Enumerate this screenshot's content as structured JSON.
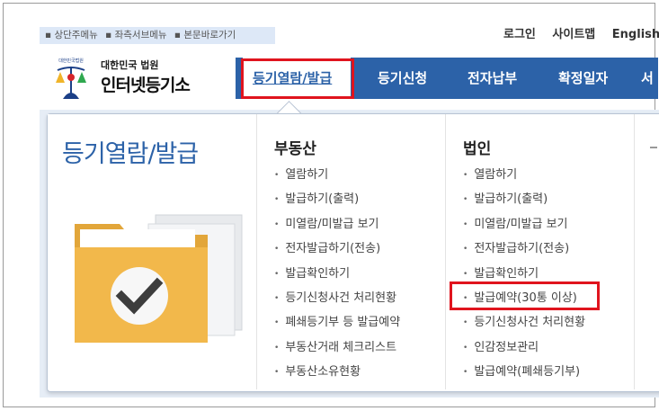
{
  "skip_nav": [
    "상단주메뉴",
    "좌측서브메뉴",
    "본문바로가기"
  ],
  "util_nav": [
    "로그인",
    "사이트맵",
    "English"
  ],
  "logo": {
    "emblem_text": "대한민국법원",
    "line1": "대한민국 법원",
    "line2": "인터넷등기소"
  },
  "gnb": [
    "등기열람/발급",
    "등기신청",
    "전자납부",
    "확정일자",
    "서"
  ],
  "dropdown": {
    "title": "등기열람/발급",
    "columns": [
      {
        "heading": "부동산",
        "items": [
          "열람하기",
          "발급하기(출력)",
          "미열람/미발급 보기",
          "전자발급하기(전송)",
          "발급확인하기",
          "등기신청사건 처리현황",
          "폐쇄등기부 등 발급예약",
          "부동산거래 체크리스트",
          "부동산소유현황"
        ]
      },
      {
        "heading": "법인",
        "items": [
          "열람하기",
          "발급하기(출력)",
          "미열람/미발급 보기",
          "전자발급하기(전송)",
          "발급확인하기",
          "발급예약(30통 이상)",
          "등기신청사건 처리현황",
          "인감정보관리",
          "발급예약(폐쇄등기부)"
        ]
      },
      {
        "heading": "",
        "items": []
      }
    ]
  },
  "colors": {
    "brand": "#2c62a8",
    "highlight": "#e0141e",
    "folder": "#f2b84b"
  }
}
